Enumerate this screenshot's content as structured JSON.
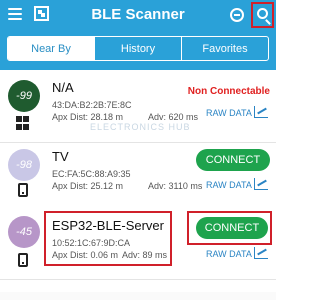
{
  "app": {
    "title": "BLE Scanner",
    "accent": "#2aa1d8"
  },
  "tabs": [
    {
      "label": "Near By",
      "active": true
    },
    {
      "label": "History",
      "active": false
    },
    {
      "label": "Favorites",
      "active": false
    }
  ],
  "devices": [
    {
      "rssi": "-99",
      "rssi_color": "#1f5b2f",
      "name": "N/A",
      "address": "43:DA:B2:2B:7E:8C",
      "dist": "Apx Dist: 28.18 m",
      "adv": "Adv: 620 ms",
      "status": "Non Connectable",
      "raw": "RAW DATA",
      "device_icon": "windows-icon"
    },
    {
      "rssi": "-98",
      "rssi_color": "#c9c7e6",
      "name": "TV",
      "address": "EC:FA:5C:88:A9:35",
      "dist": "Apx Dist: 25.12 m",
      "adv": "Adv: 3110 ms",
      "action": "CONNECT",
      "raw": "RAW DATA",
      "device_icon": "phone-icon"
    },
    {
      "rssi": "-45",
      "rssi_color": "#b796c8",
      "name": "ESP32-BLE-Server",
      "address": "10:52:1C:67:9D:CA",
      "dist": "Apx Dist: 0.06 m",
      "adv": "Adv: 89 ms",
      "action": "CONNECT",
      "raw": "RAW DATA",
      "device_icon": "phone-icon"
    }
  ],
  "watermark": "ELECTRONICS HUB"
}
